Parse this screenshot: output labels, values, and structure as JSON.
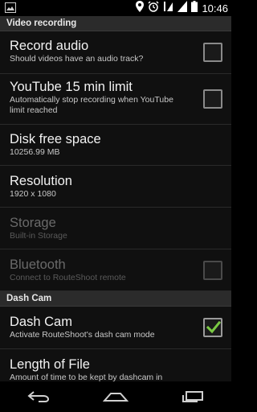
{
  "status_bar": {
    "time": "10:46",
    "icons": [
      "image-notification-icon",
      "location-icon",
      "alarm-icon",
      "wifi-icon",
      "signal-icon",
      "battery-icon"
    ]
  },
  "sections": {
    "video_recording": {
      "header": "Video recording",
      "items": [
        {
          "title": "Record audio",
          "summary": "Should videos have an audio track?",
          "checkbox": true,
          "checked": false,
          "enabled": true
        },
        {
          "title": "YouTube 15 min limit",
          "summary": "Automatically stop recording when YouTube limit reached",
          "checkbox": true,
          "checked": false,
          "enabled": true
        },
        {
          "title": "Disk free space",
          "summary": "10256.99 MB",
          "checkbox": false,
          "enabled": true
        },
        {
          "title": "Resolution",
          "summary": "1920 x 1080",
          "checkbox": false,
          "enabled": true
        },
        {
          "title": "Storage",
          "summary": "Built-in Storage",
          "checkbox": false,
          "enabled": false
        },
        {
          "title": "Bluetooth",
          "summary": "Connect to RouteShoot remote",
          "checkbox": true,
          "checked": false,
          "enabled": false
        }
      ]
    },
    "dash_cam": {
      "header": "Dash Cam",
      "items": [
        {
          "title": "Dash Cam",
          "summary": "Activate RouteShoot's dash cam mode",
          "checkbox": true,
          "checked": true,
          "enabled": true
        },
        {
          "title": "Length of File",
          "summary": "Amount of time to be kept by dashcam in seconds",
          "checkbox": false,
          "enabled": true
        }
      ]
    }
  },
  "nav_bar": {
    "buttons": [
      "back-icon",
      "home-icon",
      "recent-apps-icon"
    ]
  },
  "colors": {
    "check_accent": "#7ac943",
    "section_header_bg": "#2b2b2b",
    "list_bg": "#101010"
  }
}
